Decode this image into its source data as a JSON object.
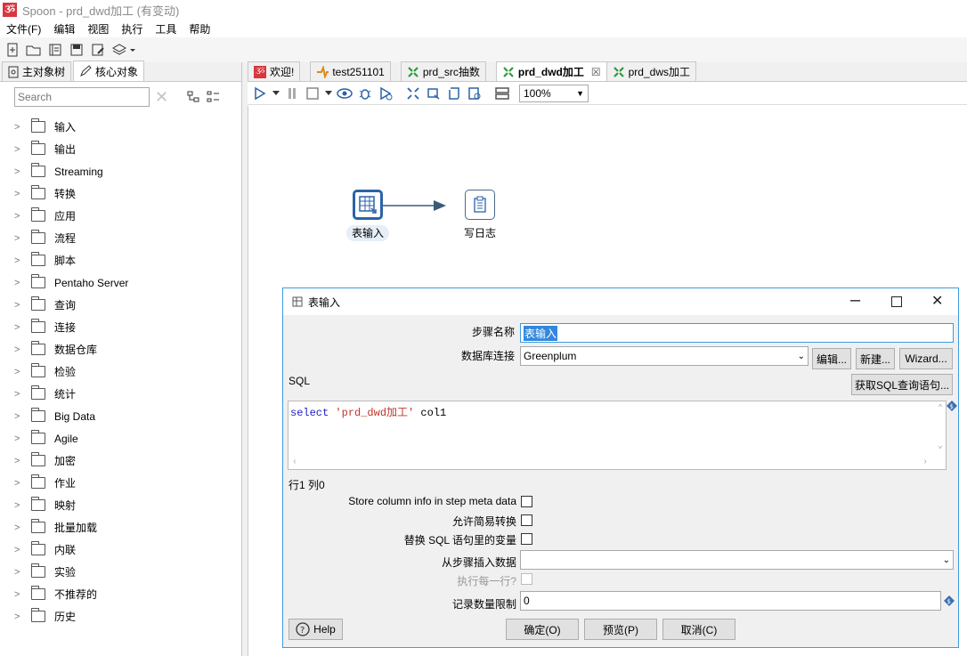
{
  "window": {
    "title": "Spoon - prd_dwd加工 (有变动)",
    "app_icon": "spoon-icon"
  },
  "menu": [
    "文件(F)",
    "编辑",
    "视图",
    "执行",
    "工具",
    "帮助"
  ],
  "left_panel": {
    "tabs": [
      "主对象树",
      "核心对象"
    ],
    "search_placeholder": "Search",
    "tree": [
      "输入",
      "输出",
      "Streaming",
      "转换",
      "应用",
      "流程",
      "脚本",
      "Pentaho Server",
      "查询",
      "连接",
      "数据仓库",
      "检验",
      "统计",
      "Big Data",
      "Agile",
      "加密",
      "作业",
      "映射",
      "批量加载",
      "内联",
      "实验",
      "不推荐的",
      "历史"
    ]
  },
  "editor_tabs": [
    "欢迎!",
    "test251101",
    "prd_src抽数",
    "prd_dwd加工",
    "prd_dws加工"
  ],
  "zoom": "100%",
  "canvas": {
    "steps": [
      {
        "label": "表输入"
      },
      {
        "label": "写日志"
      }
    ]
  },
  "dialog": {
    "title": "表输入",
    "step_name_label": "步骤名称",
    "step_name_value": "表输入",
    "db_conn_label": "数据库连接",
    "db_conn_value": "Greenplum",
    "edit_btn": "编辑...",
    "new_btn": "新建...",
    "wizard_btn": "Wizard...",
    "sql_label": "SQL",
    "get_sql_btn": "获取SQL查询语句...",
    "sql_keyword": "select",
    "sql_string": "'prd_dwd加工'",
    "sql_rest": " col1",
    "cursor_pos": "行1 列0",
    "store_col_label": "Store column info in step meta data",
    "lazy_conv_label": "允许简易转换",
    "replace_var_label": "替换 SQL 语句里的变量",
    "insert_from_label": "从步骤插入数据",
    "exec_each_label": "执行每一行?",
    "limit_label": "记录数量限制",
    "limit_value": "0",
    "help_btn": "Help",
    "ok_btn": "确定(O)",
    "preview_btn": "预览(P)",
    "cancel_btn": "取消(C)"
  }
}
